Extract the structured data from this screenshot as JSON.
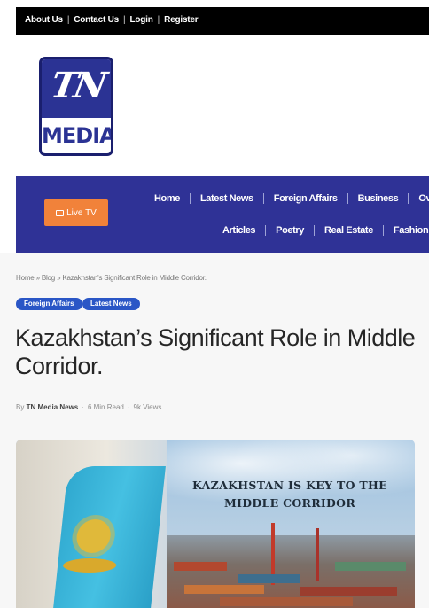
{
  "top_links": [
    "About Us",
    "Contact Us",
    "Login",
    "Register"
  ],
  "logo": {
    "tn": "TN",
    "media": "MEDIA"
  },
  "live_tv": {
    "label": "Live TV"
  },
  "nav": {
    "row1": [
      "Home",
      "Latest News",
      "Foreign Affairs",
      "Business",
      "Overse"
    ],
    "row2": [
      "Articles",
      "Poetry",
      "Real Estate",
      "Fashion"
    ]
  },
  "breadcrumb": "Home » Blog » Kazakhstan's Significant Role in Middle Corridor.",
  "tags": [
    "Foreign Affairs",
    "Latest News"
  ],
  "article": {
    "title": "Kazakhstan’s Significant Role in Middle Corridor.",
    "by": "By",
    "author": "TN Media News",
    "read_time": "6 Min Read",
    "views": "9k Views"
  },
  "hero": {
    "line1": "KAZAKHSTAN IS KEY TO THE",
    "line2": "MIDDLE CORRIDOR"
  },
  "colors": {
    "navbar": "#2f3296",
    "live_tv": "#f1823a",
    "tag": "#2a56c6",
    "logo_blue": "#2b3394"
  }
}
